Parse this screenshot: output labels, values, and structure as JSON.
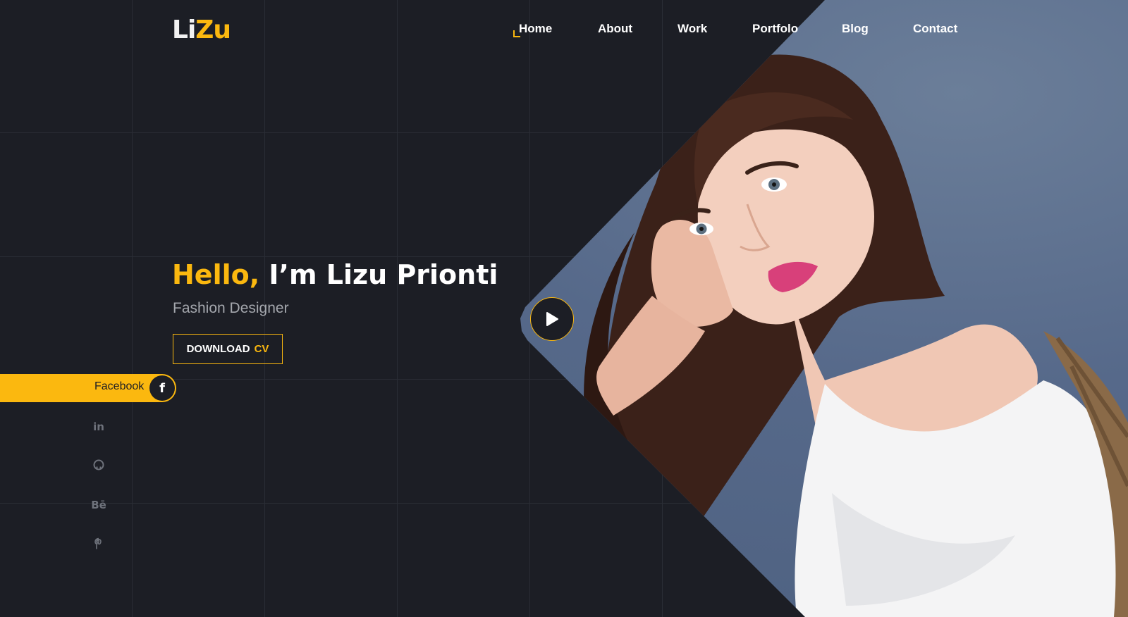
{
  "logo": {
    "part1": "Li",
    "part2": "Zu"
  },
  "nav": {
    "items": [
      {
        "label": "Home",
        "active": true
      },
      {
        "label": "About"
      },
      {
        "label": "Work"
      },
      {
        "label": "Portfolo"
      },
      {
        "label": "Blog"
      },
      {
        "label": "Contact"
      }
    ]
  },
  "hero": {
    "greeting": "Hello,",
    "name": "I’m Lizu Prionti",
    "subtitle": "Fashion Designer",
    "cv_button": {
      "part1": "DOWNLOAD",
      "part2": "CV"
    }
  },
  "social": {
    "facebook_label": "Facebook",
    "facebook_icon": "f",
    "linkedin_icon": "in",
    "github_icon": "⭘",
    "behance_icon": "Bē",
    "pinterest_icon": "℗"
  },
  "colors": {
    "accent": "#fbb80f",
    "background": "#1c1e25",
    "text": "#ffffff",
    "muted": "#a4a7ad"
  }
}
